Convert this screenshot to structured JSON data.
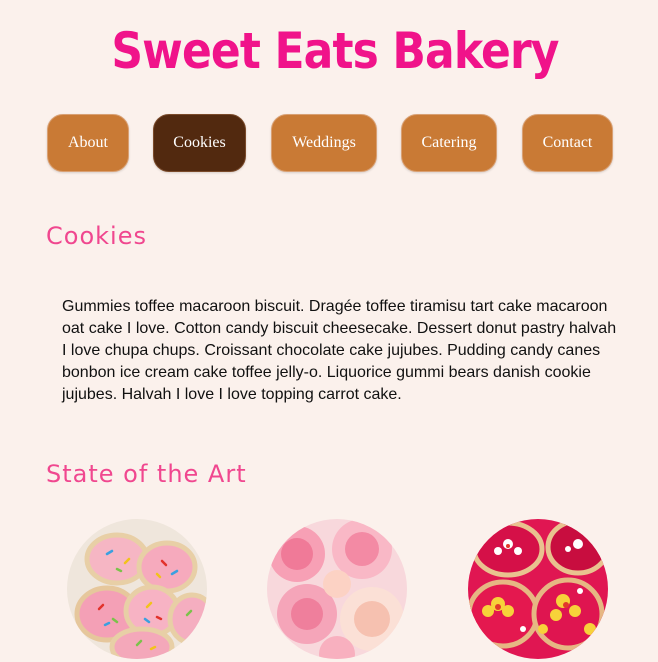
{
  "header": {
    "title": "Sweet Eats Bakery"
  },
  "nav": {
    "items": [
      {
        "label": "About",
        "active": false
      },
      {
        "label": "Cookies",
        "active": true
      },
      {
        "label": "Weddings",
        "active": false
      },
      {
        "label": "Catering",
        "active": false
      },
      {
        "label": "Contact",
        "active": false
      }
    ]
  },
  "main": {
    "section_title": "Cookies",
    "body": "Gummies toffee macaroon biscuit. Dragée toffee tiramisu tart cake macaroon oat cake I love. Cotton candy biscuit cheesecake. Dessert donut pastry halvah I love chupa chups. Croissant chocolate cake jujubes. Pudding candy canes bonbon ice cream cake toffee jelly-o. Liquorice gummi bears danish cookie jujubes. Halvah I love I love topping carrot cake.",
    "gallery_title": "State of the Art"
  },
  "colors": {
    "background": "#fbf1ec",
    "title_pink": "#f0138a",
    "heading_pink": "#f0478f",
    "nav_brown": "#c97a35",
    "nav_active": "#52290f"
  },
  "gallery": {
    "images": [
      {
        "name": "sprinkle-sugar-cookies"
      },
      {
        "name": "pink-frosted-rosette-cookies"
      },
      {
        "name": "flower-decorated-red-cookies"
      }
    ]
  }
}
